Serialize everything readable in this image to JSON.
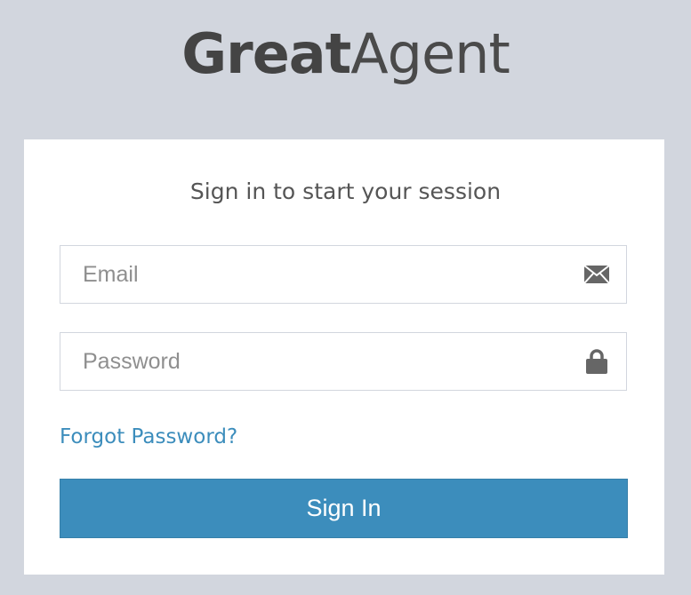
{
  "logo": {
    "bold": "Great",
    "light": "Agent"
  },
  "login_box": {
    "message": "Sign in to start your session",
    "email": {
      "placeholder": "Email",
      "value": "",
      "icon": "envelope-icon"
    },
    "password": {
      "placeholder": "Password",
      "value": "",
      "icon": "lock-icon"
    },
    "forgot_link": "Forgot Password?",
    "submit_label": "Sign In"
  },
  "colors": {
    "background": "#d2d6de",
    "accent": "#3c8dbc",
    "box": "#ffffff",
    "text": "#444444"
  }
}
